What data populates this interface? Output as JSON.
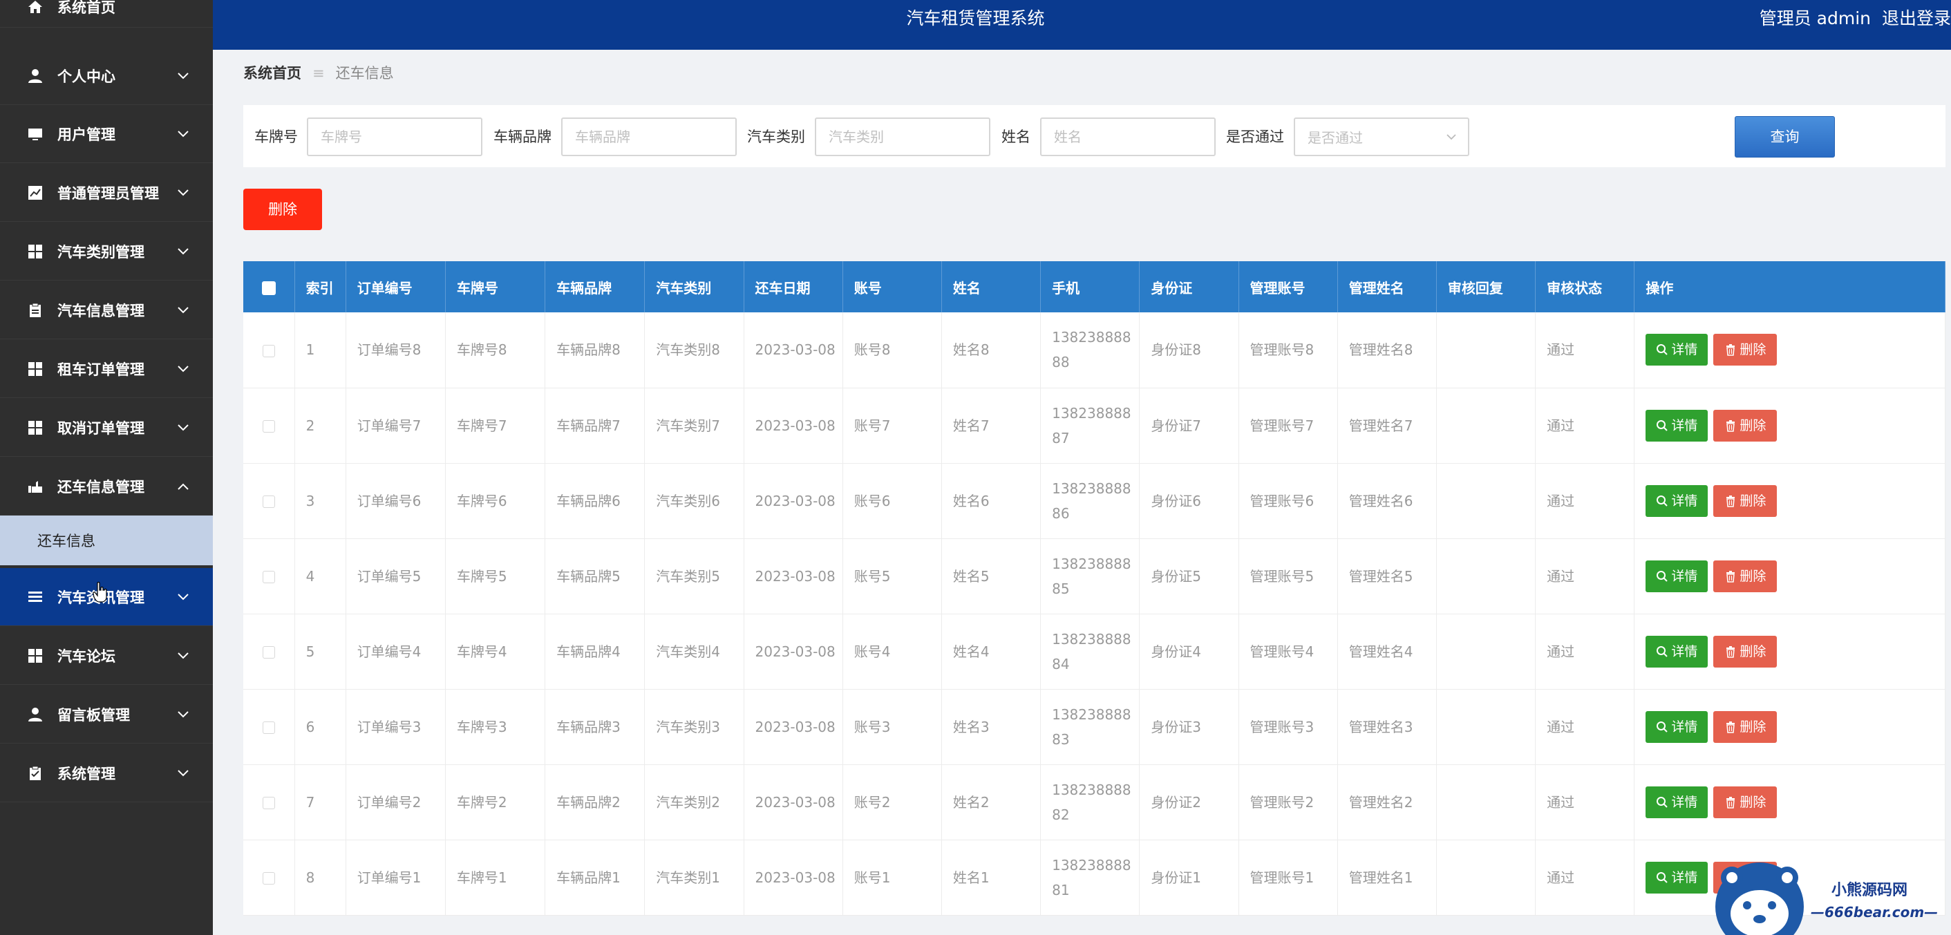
{
  "header": {
    "title": "汽车租赁管理系统",
    "user_label": "管理员 admin",
    "logout_label": "退出登录"
  },
  "sidebar": {
    "items": [
      {
        "label": "系统首页",
        "icon": "home-icon"
      },
      {
        "label": "个人中心",
        "icon": "person-icon"
      },
      {
        "label": "用户管理",
        "icon": "monitor-icon"
      },
      {
        "label": "普通管理员管理",
        "icon": "chart-icon"
      },
      {
        "label": "汽车类别管理",
        "icon": "grid-icon"
      },
      {
        "label": "汽车信息管理",
        "icon": "clipboard-icon"
      },
      {
        "label": "租车订单管理",
        "icon": "grid-icon"
      },
      {
        "label": "取消订单管理",
        "icon": "grid-icon"
      },
      {
        "label": "还车信息管理",
        "icon": "hand-icon"
      },
      {
        "label": "汽车资讯管理",
        "icon": "list-icon"
      },
      {
        "label": "汽车论坛",
        "icon": "grid-icon"
      },
      {
        "label": "留言板管理",
        "icon": "person-icon"
      },
      {
        "label": "系统管理",
        "icon": "clipboard-icon"
      }
    ],
    "submenu": {
      "label": "还车信息"
    }
  },
  "breadcrumb": {
    "home": "系统首页",
    "separator": "≡",
    "current": "还车信息"
  },
  "search": {
    "plate_label": "车牌号",
    "plate_placeholder": "车牌号",
    "brand_label": "车辆品牌",
    "brand_placeholder": "车辆品牌",
    "category_label": "汽车类别",
    "category_placeholder": "汽车类别",
    "name_label": "姓名",
    "name_placeholder": "姓名",
    "approved_label": "是否通过",
    "approved_placeholder": "是否通过",
    "query_button": "查询"
  },
  "actions": {
    "bulk_delete": "删除",
    "detail": "详情",
    "delete": "删除"
  },
  "table": {
    "columns": [
      "索引",
      "订单编号",
      "车牌号",
      "车辆品牌",
      "汽车类别",
      "还车日期",
      "账号",
      "姓名",
      "手机",
      "身份证",
      "管理账号",
      "管理姓名",
      "审核回复",
      "审核状态",
      "操作"
    ],
    "rows": [
      {
        "index": "1",
        "order_no": "订单编号8",
        "plate": "车牌号8",
        "brand": "车辆品牌8",
        "category": "汽车类别8",
        "return_date": "2023-03-08",
        "account": "账号8",
        "name": "姓名8",
        "phone": "13823888888",
        "id_card": "身份证8",
        "admin_account": "管理账号8",
        "admin_name": "管理姓名8",
        "reply": "",
        "status": "通过"
      },
      {
        "index": "2",
        "order_no": "订单编号7",
        "plate": "车牌号7",
        "brand": "车辆品牌7",
        "category": "汽车类别7",
        "return_date": "2023-03-08",
        "account": "账号7",
        "name": "姓名7",
        "phone": "13823888887",
        "id_card": "身份证7",
        "admin_account": "管理账号7",
        "admin_name": "管理姓名7",
        "reply": "",
        "status": "通过"
      },
      {
        "index": "3",
        "order_no": "订单编号6",
        "plate": "车牌号6",
        "brand": "车辆品牌6",
        "category": "汽车类别6",
        "return_date": "2023-03-08",
        "account": "账号6",
        "name": "姓名6",
        "phone": "13823888886",
        "id_card": "身份证6",
        "admin_account": "管理账号6",
        "admin_name": "管理姓名6",
        "reply": "",
        "status": "通过"
      },
      {
        "index": "4",
        "order_no": "订单编号5",
        "plate": "车牌号5",
        "brand": "车辆品牌5",
        "category": "汽车类别5",
        "return_date": "2023-03-08",
        "account": "账号5",
        "name": "姓名5",
        "phone": "13823888885",
        "id_card": "身份证5",
        "admin_account": "管理账号5",
        "admin_name": "管理姓名5",
        "reply": "",
        "status": "通过"
      },
      {
        "index": "5",
        "order_no": "订单编号4",
        "plate": "车牌号4",
        "brand": "车辆品牌4",
        "category": "汽车类别4",
        "return_date": "2023-03-08",
        "account": "账号4",
        "name": "姓名4",
        "phone": "13823888884",
        "id_card": "身份证4",
        "admin_account": "管理账号4",
        "admin_name": "管理姓名4",
        "reply": "",
        "status": "通过"
      },
      {
        "index": "6",
        "order_no": "订单编号3",
        "plate": "车牌号3",
        "brand": "车辆品牌3",
        "category": "汽车类别3",
        "return_date": "2023-03-08",
        "account": "账号3",
        "name": "姓名3",
        "phone": "13823888883",
        "id_card": "身份证3",
        "admin_account": "管理账号3",
        "admin_name": "管理姓名3",
        "reply": "",
        "status": "通过"
      },
      {
        "index": "7",
        "order_no": "订单编号2",
        "plate": "车牌号2",
        "brand": "车辆品牌2",
        "category": "汽车类别2",
        "return_date": "2023-03-08",
        "account": "账号2",
        "name": "姓名2",
        "phone": "13823888882",
        "id_card": "身份证2",
        "admin_account": "管理账号2",
        "admin_name": "管理姓名2",
        "reply": "",
        "status": "通过"
      },
      {
        "index": "8",
        "order_no": "订单编号1",
        "plate": "车牌号1",
        "brand": "车辆品牌1",
        "category": "汽车类别1",
        "return_date": "2023-03-08",
        "account": "账号1",
        "name": "姓名1",
        "phone": "13823888881",
        "id_card": "身份证1",
        "admin_account": "管理账号1",
        "admin_name": "管理姓名1",
        "reply": "",
        "status": "通过"
      }
    ]
  },
  "watermark": {
    "title": "小熊源码网",
    "url": "—666bear.com—"
  },
  "colors": {
    "header_bg": "#0a3a8f",
    "sidebar_bg": "#2f2f2f",
    "table_header_bg": "#2a7cc8",
    "detail_green": "#2fa12f",
    "delete_red": "#e5604d",
    "bulk_delete_red": "#ff2a12"
  }
}
